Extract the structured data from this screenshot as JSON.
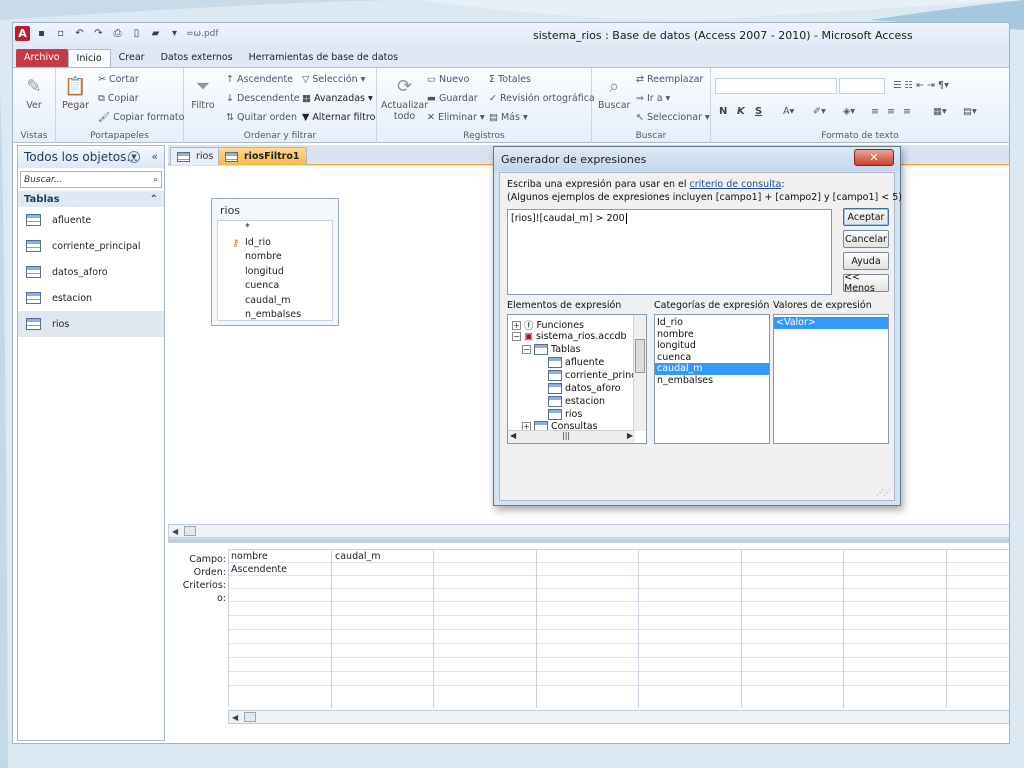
{
  "window": {
    "title": "sistema_rios : Base de datos (Access 2007 - 2010)  -  Microsoft Access",
    "quick_access_extra": "=ω.pdf"
  },
  "ribbon_tabs": [
    "Archivo",
    "Inicio",
    "Crear",
    "Datos externos",
    "Herramientas de base de datos"
  ],
  "ribbon": {
    "vistas": {
      "ver": "Ver",
      "group": "Vistas"
    },
    "portapapeles": {
      "pegar": "Pegar",
      "cortar": "Cortar",
      "copiar": "Copiar",
      "copiar_formato": "Copiar formato",
      "group": "Portapapeles"
    },
    "ordenar": {
      "filtro": "Filtro",
      "ascendente": "Ascendente",
      "descendente": "Descendente",
      "quitar_orden": "Quitar orden",
      "seleccion": "Selección",
      "avanzadas": "Avanzadas",
      "alternar": "Alternar filtro",
      "group": "Ordenar y filtrar"
    },
    "registros": {
      "actualizar": "Actualizar",
      "actualizar2": "todo",
      "nuevo": "Nuevo",
      "guardar": "Guardar",
      "eliminar": "Eliminar",
      "totales": "Totales",
      "revision": "Revisión ortográfica",
      "mas": "Más",
      "group": "Registros"
    },
    "buscar": {
      "buscar": "Buscar",
      "reemplazar": "Reemplazar",
      "ir_a": "Ir a",
      "seleccionar": "Seleccionar",
      "group": "Buscar"
    },
    "formato": {
      "bold": "N",
      "italic": "K",
      "underline": "S",
      "group": "Formato de texto"
    }
  },
  "nav": {
    "title": "Todos los objetos...",
    "search_placeholder": "Buscar...",
    "section": "Tablas",
    "items": [
      "afluente",
      "corriente_principal",
      "datos_aforo",
      "estacion",
      "rios"
    ]
  },
  "doc_tabs": [
    "rios",
    "riosFiltro1"
  ],
  "table_box": {
    "title": "rios",
    "fields": [
      "*",
      "Id_rio",
      "nombre",
      "longitud",
      "cuenca",
      "caudal_m",
      "n_embalses"
    ]
  },
  "query_grid": {
    "row_labels": [
      "Campo:",
      "Orden:",
      "Criterios:",
      "o:"
    ],
    "col1": {
      "campo": "nombre",
      "orden": "Ascendente"
    },
    "col2": {
      "campo": "caudal_m"
    }
  },
  "dialog": {
    "title": "Generador de expresiones",
    "instruction_prefix": "Escriba una expresión para usar en el ",
    "instruction_link": "criterio de consulta",
    "instruction_suffix": ":",
    "examples": "(Algunos ejemplos de expresiones incluyen [campo1] + [campo2] y [campo1] < 5)",
    "expression": "[rios]![caudal_m] > 200",
    "buttons": {
      "aceptar": "Aceptar",
      "cancelar": "Cancelar",
      "ayuda": "Ayuda",
      "menos": "<< Menos"
    },
    "labels": {
      "elementos": "Elementos de expresión",
      "categorias": "Categorías de expresión",
      "valores": "Valores de expresión"
    },
    "tree": {
      "funciones": "Funciones",
      "db": "sistema_rios.accdb",
      "tablas": "Tablas",
      "items": [
        "afluente",
        "corriente_princip",
        "datos_aforo",
        "estacion",
        "rios"
      ],
      "consultas": "Consultas"
    },
    "categories": [
      "Id_rio",
      "nombre",
      "longitud",
      "cuenca",
      "caudal_m",
      "n_embalses"
    ],
    "selected_category": "caudal_m",
    "values": [
      "<Valor>"
    ]
  }
}
